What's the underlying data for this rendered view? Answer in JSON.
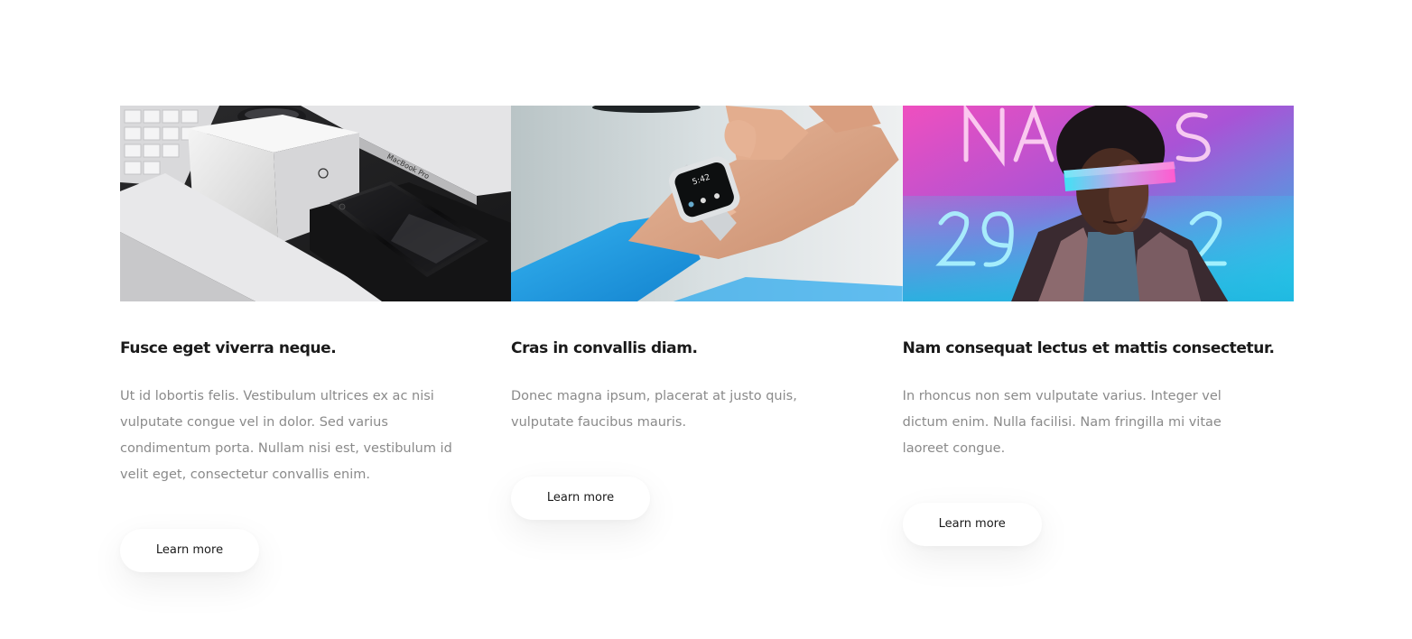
{
  "cards": [
    {
      "image": "macbook-iphone-product-photo",
      "title": "Fusce eget viverra neque.",
      "text": "Ut id lobortis felis. Vestibulum ultrices ex ac nisi vulputate congue vel in dolor. Sed varius condimentum porta. Nullam nisi est, vestibulum id velit eget, consectetur convallis enim.",
      "button": "Learn more",
      "image_text": "MacBook Pro"
    },
    {
      "image": "smartwatch-wrist-photo",
      "title": "Cras in convallis diam.",
      "text": "Donec magna ipsum, placerat at justo quis, vulputate faucibus mauris.",
      "button": "Learn more"
    },
    {
      "image": "neon-cyberpunk-portrait-photo",
      "title": "Nam consequat lectus et mattis consectetur.",
      "text": "In rhoncus non sem vulputate varius. Integer vel dictum enim. Nulla facilisi. Nam fringilla mi vitae laoreet congue.",
      "button": "Learn more"
    }
  ],
  "colors": {
    "title": "#1a1a1a",
    "text": "#8a8a8a",
    "button_bg": "#ffffff",
    "neon_pink": "#ff4fc8",
    "neon_cyan": "#27d3f0",
    "watch_blue": "#1c9fe0"
  }
}
